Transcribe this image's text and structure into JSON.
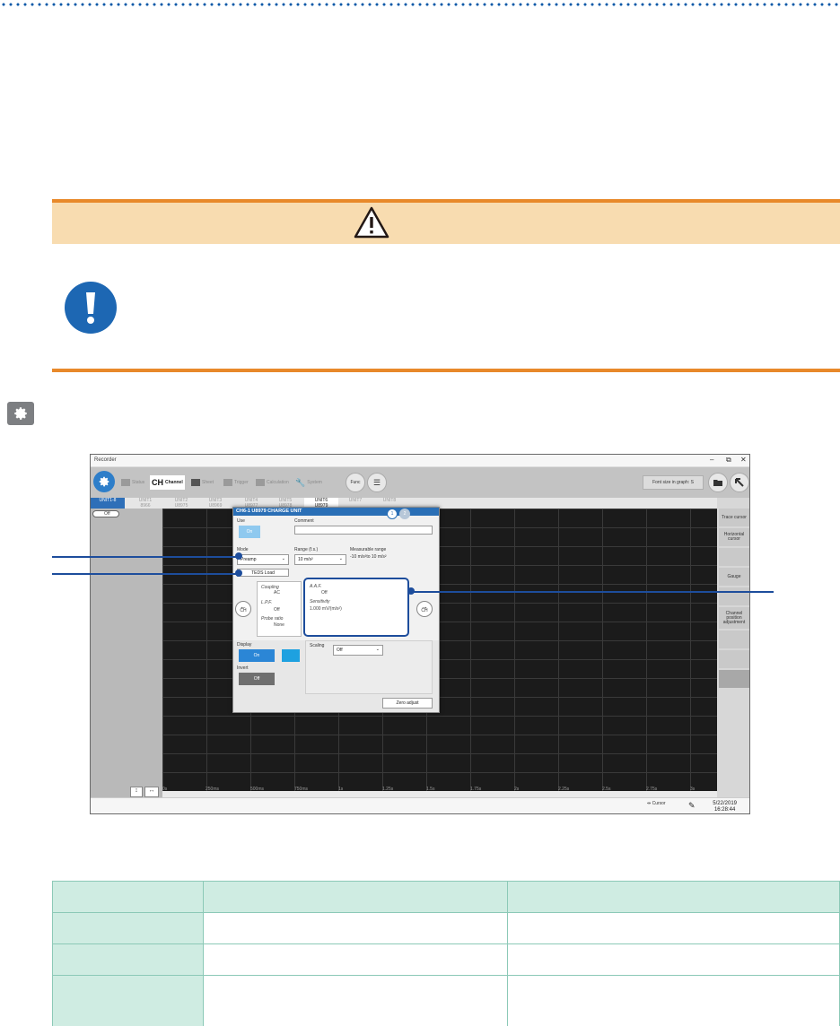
{
  "screenshot": {
    "window_title": "Recorder",
    "window_controls": {
      "minimize": "–",
      "maximize": "⧉",
      "close": "✕"
    },
    "toolbar": {
      "items": [
        {
          "label": "Status",
          "active": false
        },
        {
          "prefix": "CH",
          "label": "Channel",
          "active": true
        },
        {
          "label": "Sheet",
          "active": false
        },
        {
          "label": "Trigger",
          "active": false
        },
        {
          "label": "Calculation",
          "active": false
        },
        {
          "label": "System",
          "active": false
        }
      ],
      "func_label": "Func",
      "font_size_label": "Font size in graph: S"
    },
    "unit_tabs": [
      {
        "top": "UNIT1-8",
        "bottom": ""
      },
      {
        "top": "UNIT1",
        "bottom": "8966"
      },
      {
        "top": "UNIT2",
        "bottom": "U8975"
      },
      {
        "top": "UNIT3",
        "bottom": "U8969"
      },
      {
        "top": "UNIT4",
        "bottom": "U8977"
      },
      {
        "top": "UNIT5",
        "bottom": "U8978"
      },
      {
        "top": "UNIT6",
        "bottom": "U8979"
      },
      {
        "top": "UNIT7",
        "bottom": ""
      },
      {
        "top": "UNIT8",
        "bottom": ""
      }
    ],
    "left_pane": {
      "ch_label": "CH6-1",
      "toggle_label": "Off"
    },
    "x_axis": [
      "0s",
      "250ms",
      "500ms",
      "750ms",
      "1s",
      "1.25s",
      "1.5s",
      "1.75s",
      "2s",
      "2.25s",
      "2.5s",
      "2.75s",
      "3s"
    ],
    "right_buttons": [
      "Trace cursor",
      "Horizontal cursor",
      "",
      "Gauge",
      "",
      "Channel position adjustment",
      "",
      "",
      ""
    ],
    "status": {
      "cursor_label": "Cursor",
      "date": "5/22/2019",
      "time": "16:28:44"
    },
    "dialog": {
      "title": "CH6-1    U8979 CHARGE UNIT",
      "pages": [
        "1",
        "2"
      ],
      "use_label": "Use",
      "use_value": "On",
      "comment_label": "Comment",
      "comment_value": "",
      "mode_label": "Mode",
      "mode_value": "Preamp",
      "range_label": "Range (f.s.)",
      "range_value": "10 m/s²",
      "measurable_label": "Measurable range",
      "measurable_value": "-10 m/s²to 10 m/s²",
      "teds_button": "TEDS Load",
      "coupling_label": "Coupling",
      "coupling_value": "AC",
      "lpf_label": "L.P.F.",
      "lpf_value": "Off",
      "probe_label": "Probe ratio",
      "probe_value": "None",
      "aaf_label": "A.A.F.",
      "aaf_value": "Off",
      "sensitivity_label": "Sensitivity",
      "sensitivity_value": "1.000 mV/(m/s²)",
      "prev_ch": "CH",
      "next_ch": "CH",
      "display_label": "Display",
      "display_value": "On",
      "invert_label": "Invert",
      "invert_value": "Off",
      "scaling_label": "Scaling",
      "scaling_value": "Off",
      "zero_adjust": "Zero adjust"
    }
  },
  "colors": {
    "caution_orange": "#e8892a",
    "caution_fill": "#f8dcb0",
    "accent_blue": "#1d67b3",
    "table_header": "#cfece2",
    "table_border": "#8cc9b7"
  },
  "table": {
    "rows": [
      [
        "",
        "",
        ""
      ],
      [
        "",
        "",
        ""
      ],
      [
        "",
        "",
        ""
      ],
      [
        "",
        "",
        ""
      ]
    ]
  }
}
